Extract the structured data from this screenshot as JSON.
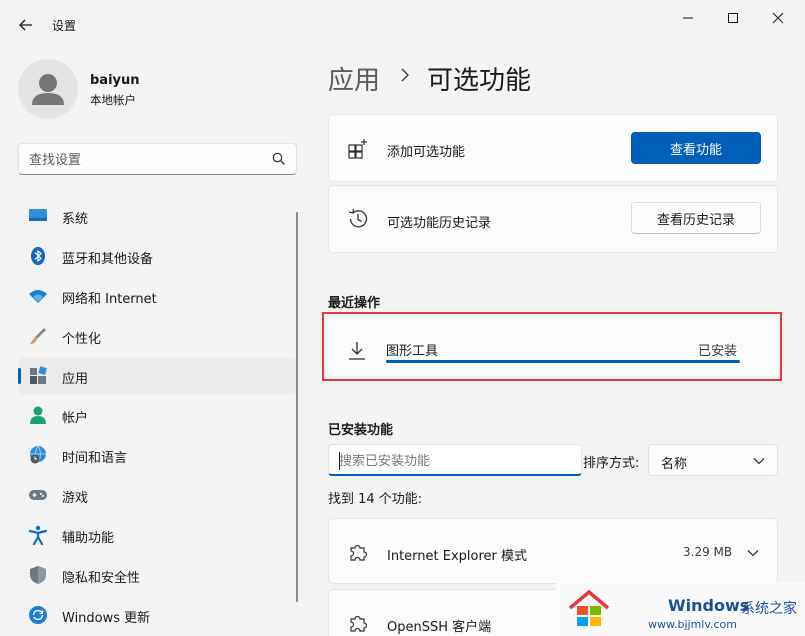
{
  "window": {
    "title": "设置"
  },
  "user": {
    "name": "baiyun",
    "account_type": "本地帐户"
  },
  "search": {
    "placeholder": "查找设置"
  },
  "nav": {
    "items": [
      {
        "label": "系统",
        "icon": "monitor-icon"
      },
      {
        "label": "蓝牙和其他设备",
        "icon": "bluetooth-icon"
      },
      {
        "label": "网络和 Internet",
        "icon": "wifi-icon"
      },
      {
        "label": "个性化",
        "icon": "brush-icon"
      },
      {
        "label": "应用",
        "icon": "apps-icon",
        "active": true
      },
      {
        "label": "帐户",
        "icon": "person-icon"
      },
      {
        "label": "时间和语言",
        "icon": "globe-clock-icon"
      },
      {
        "label": "游戏",
        "icon": "gamepad-icon"
      },
      {
        "label": "辅助功能",
        "icon": "accessibility-icon"
      },
      {
        "label": "隐私和安全性",
        "icon": "shield-icon"
      },
      {
        "label": "Windows 更新",
        "icon": "update-icon"
      }
    ]
  },
  "breadcrumb": {
    "parent": "应用",
    "current": "可选功能"
  },
  "add_feature": {
    "label": "添加可选功能",
    "button": "查看功能"
  },
  "history": {
    "label": "可选功能历史记录",
    "button": "查看历史记录"
  },
  "recent": {
    "title": "最近操作",
    "item": {
      "name": "图形工具",
      "status": "已安装",
      "progress": 1.0
    }
  },
  "installed": {
    "title": "已安装功能",
    "search_placeholder": "搜索已安装功能",
    "sort_label": "排序方式:",
    "sort_value": "名称",
    "found_text": "找到 14 个功能:",
    "features": [
      {
        "name": "Internet Explorer 模式",
        "size": "3.29 MB"
      },
      {
        "name": "OpenSSH 客户端",
        "size": ""
      }
    ]
  },
  "watermark": {
    "brand": "Windows",
    "brand2": "系统之家",
    "url": "www.bjjmlv.com"
  },
  "colors": {
    "accent": "#005fb8",
    "highlight": "#e03a3a",
    "background": "#f3f3f3"
  }
}
